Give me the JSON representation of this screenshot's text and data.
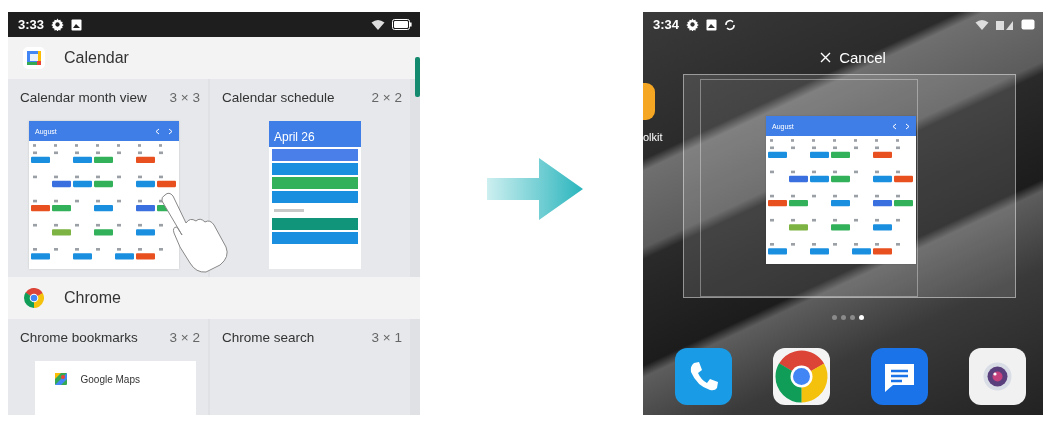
{
  "left_screen": {
    "status_bar": {
      "time": "3:33"
    },
    "apps": [
      {
        "name": "Calendar",
        "kind": "calendar",
        "widgets": [
          {
            "title": "Calendar month view",
            "size": "3 × 3",
            "kind": "month",
            "month": "August"
          },
          {
            "title": "Calendar schedule",
            "size": "2 × 2",
            "kind": "schedule",
            "date": "April 26",
            "events": [
              {
                "kind": "event",
                "color": "#4a7ee8"
              },
              {
                "kind": "event",
                "color": "#1a8fe0"
              },
              {
                "kind": "event",
                "color": "#33b05a"
              },
              {
                "kind": "event",
                "color": "#1a8fe0"
              },
              {
                "kind": "day"
              },
              {
                "kind": "event",
                "color": "#10957a"
              },
              {
                "kind": "event",
                "color": "#1a8fe0"
              }
            ]
          }
        ]
      },
      {
        "name": "Chrome",
        "kind": "chrome",
        "widgets": [
          {
            "title": "Chrome bookmarks",
            "size": "3 × 2",
            "kind": "bookmarks",
            "bookmarks": [
              "Google Maps"
            ]
          },
          {
            "title": "Chrome search",
            "size": "3 × 1",
            "kind": "empty"
          }
        ]
      }
    ]
  },
  "right_screen": {
    "status_bar": {
      "time": "3:34"
    },
    "cancel_label": "Cancel",
    "app_label": "olkit",
    "widget_month": "August",
    "pages": [
      {
        "selected": false
      },
      {
        "selected": false
      },
      {
        "selected": false
      },
      {
        "selected": true
      }
    ],
    "dock": [
      {
        "kind": "phone"
      },
      {
        "kind": "chrome"
      },
      {
        "kind": "messages"
      },
      {
        "kind": "camera"
      }
    ]
  }
}
